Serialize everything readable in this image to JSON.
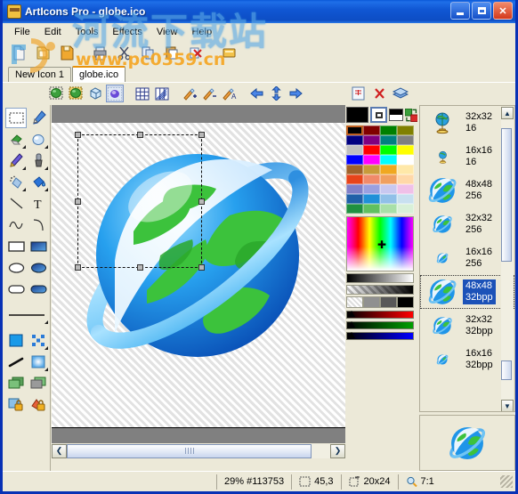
{
  "window": {
    "title": "ArtIcons Pro - globe.ico",
    "app_icon": "app-icon",
    "minimize_label": "Minimize",
    "maximize_label": "Maximize",
    "close_label": "Close",
    "close_glyph": "✕"
  },
  "menu": {
    "items": [
      {
        "label": "File",
        "mnemonic": "F"
      },
      {
        "label": "Edit",
        "mnemonic": "E"
      },
      {
        "label": "Tools",
        "mnemonic": "T"
      },
      {
        "label": "Effects",
        "mnemonic": "E"
      },
      {
        "label": "View",
        "mnemonic": "V"
      },
      {
        "label": "Help",
        "mnemonic": "H"
      }
    ]
  },
  "main_toolbar": {
    "buttons": [
      {
        "name": "new-icon-button",
        "icon": "new-document-icon"
      },
      {
        "name": "open-button",
        "icon": "open-folder-icon"
      },
      {
        "name": "save-button",
        "icon": "save-disk-icon"
      },
      {
        "name": "print-button",
        "icon": "print-icon"
      },
      {
        "name": "cut-button",
        "icon": "scissors-icon"
      },
      {
        "name": "copy-button",
        "icon": "copy-icon"
      },
      {
        "name": "paste-button",
        "icon": "paste-icon"
      },
      {
        "name": "delete-button",
        "icon": "delete-red-x-icon"
      },
      {
        "name": "properties-button",
        "icon": "properties-icon"
      }
    ]
  },
  "tabs": {
    "items": [
      {
        "label": "New Icon 1",
        "active": false
      },
      {
        "label": "globe.ico",
        "active": true
      }
    ]
  },
  "image_toolbar": {
    "buttons": [
      {
        "name": "add-image-button",
        "icon": "green-image-add-icon",
        "selected": false
      },
      {
        "name": "duplicate-image-button",
        "icon": "green-image-copy-icon",
        "selected": false
      },
      {
        "name": "image-3d-button",
        "icon": "cube-icon",
        "selected": false
      },
      {
        "name": "transparency-button",
        "icon": "alpha-blob-icon",
        "selected": true
      },
      {
        "name": "grid-button",
        "icon": "grid-icon",
        "selected": false
      },
      {
        "name": "pixel-grid-button",
        "icon": "pixel-grid-icon",
        "selected": false
      },
      {
        "name": "zoom-in-button",
        "icon": "magic-wand-plus-icon",
        "selected": false
      },
      {
        "name": "zoom-out-button",
        "icon": "magic-wand-minus-icon",
        "selected": false
      },
      {
        "name": "auto-button",
        "icon": "magic-wand-a-icon",
        "selected": false
      },
      {
        "name": "move-left-button",
        "icon": "arrow-left-blue-icon",
        "selected": false
      },
      {
        "name": "move-vertical-button",
        "icon": "arrow-updown-blue-icon",
        "selected": false
      },
      {
        "name": "move-right-button",
        "icon": "arrow-right-blue-icon",
        "selected": false
      }
    ],
    "right_buttons": [
      {
        "name": "format-button",
        "icon": "page-format-icon"
      },
      {
        "name": "remove-format-button",
        "icon": "red-x-icon"
      },
      {
        "name": "layers-button",
        "icon": "layers-icon"
      }
    ]
  },
  "tool_palette": {
    "rows": [
      [
        {
          "name": "select-rectangle-tool",
          "icon": "marquee-icon",
          "selected": true
        },
        {
          "name": "pen-tool",
          "icon": "pen-icon",
          "selected": false
        }
      ],
      [
        {
          "name": "eraser-tool",
          "icon": "eraser-icon",
          "selected": false
        },
        {
          "name": "color-eraser-tool",
          "icon": "drop-eraser-icon",
          "selected": false
        }
      ],
      [
        {
          "name": "pencil-tool",
          "icon": "pencil-icon",
          "selected": false
        },
        {
          "name": "brush-tool",
          "icon": "brush-icon",
          "selected": false
        }
      ],
      [
        {
          "name": "airbrush-tool",
          "icon": "airbrush-icon",
          "selected": false
        },
        {
          "name": "fill-tool",
          "icon": "paint-bucket-icon",
          "selected": false
        }
      ],
      [
        {
          "name": "line-tool",
          "icon": "line-icon",
          "selected": false
        },
        {
          "name": "text-tool",
          "icon": "text-t-icon",
          "selected": false
        }
      ],
      [
        {
          "name": "curve-tool",
          "icon": "wave-curve-icon",
          "selected": false
        },
        {
          "name": "arc-tool",
          "icon": "arc-icon",
          "selected": false
        }
      ],
      [
        {
          "name": "rectangle-outline-tool",
          "icon": "rectangle-outline-icon",
          "selected": false
        },
        {
          "name": "rectangle-filled-tool",
          "icon": "rectangle-filled-icon",
          "selected": false
        }
      ],
      [
        {
          "name": "ellipse-outline-tool",
          "icon": "ellipse-outline-icon",
          "selected": false
        },
        {
          "name": "ellipse-filled-tool",
          "icon": "ellipse-filled-icon",
          "selected": false
        }
      ],
      [
        {
          "name": "rounded-rect-outline-tool",
          "icon": "rounded-rect-outline-icon",
          "selected": false
        },
        {
          "name": "rounded-rect-filled-tool",
          "icon": "rounded-rect-filled-icon",
          "selected": false
        }
      ]
    ],
    "line_width_selector": {
      "name": "line-width-selector",
      "icon": "line-thickness-icon"
    },
    "extras": [
      [
        {
          "name": "solid-fill-style",
          "icon": "solid-square-icon"
        },
        {
          "name": "pattern-fill-style",
          "icon": "pattern-dots-icon"
        }
      ],
      [
        {
          "name": "gradient-line-style",
          "icon": "gradient-stroke-icon"
        },
        {
          "name": "gradient-fill-style",
          "icon": "gradient-fill-icon"
        }
      ],
      [
        {
          "name": "image-layer-green",
          "icon": "layer-green-icon"
        },
        {
          "name": "image-layer-gray",
          "icon": "layer-gray-icon"
        }
      ],
      [
        {
          "name": "lock-image-button",
          "icon": "lock-blue-icon"
        },
        {
          "name": "lock-alpha-button",
          "icon": "lock-orange-icon"
        }
      ]
    ]
  },
  "colors": {
    "foreground": "#000000",
    "background": "#ffffff",
    "selected_swatch_index": 0,
    "palette": [
      "#000000",
      "#800000",
      "#008000",
      "#808000",
      "#000080",
      "#800080",
      "#008080",
      "#808080",
      "#c0c0c0",
      "#ff0000",
      "#00ff00",
      "#ffff00",
      "#0000ff",
      "#ff00ff",
      "#00ffff",
      "#ffffff",
      "#a0622a",
      "#c89a3a",
      "#f0a820",
      "#ffe8a8",
      "#e8441a",
      "#f08a6a",
      "#f0a060",
      "#ffd8a8",
      "#8080c8",
      "#9aa0e0",
      "#c8c8f0",
      "#f0c0e8",
      "#2060a8",
      "#2090d8",
      "#90c0e8",
      "#c8e0f0",
      "#209040",
      "#60c060",
      "#a8e0a8",
      "#d8f0d8"
    ],
    "alpha_chips": [
      "#e8e8e8",
      "#909090",
      "#585858",
      "#000000"
    ],
    "channels": [
      {
        "name": "red-channel-slider",
        "color": "#ff0000"
      },
      {
        "name": "green-channel-slider",
        "color": "#00a000"
      },
      {
        "name": "blue-channel-slider",
        "color": "#0000ff"
      }
    ]
  },
  "icon_list": {
    "items": [
      {
        "size": "32x32",
        "depth": "16",
        "thumb": "globe-stand-32",
        "selected": false
      },
      {
        "size": "16x16",
        "depth": "16",
        "thumb": "globe-stand-16",
        "selected": false
      },
      {
        "size": "48x48",
        "depth": "256",
        "thumb": "globe-orbit-48",
        "selected": false
      },
      {
        "size": "32x32",
        "depth": "256",
        "thumb": "globe-orbit-32",
        "selected": false
      },
      {
        "size": "16x16",
        "depth": "256",
        "thumb": "globe-orbit-16",
        "selected": false
      },
      {
        "size": "48x48",
        "depth": "32bpp",
        "thumb": "globe-orbit-48",
        "selected": true
      },
      {
        "size": "32x32",
        "depth": "32bpp",
        "thumb": "globe-orbit-32",
        "selected": false
      },
      {
        "size": "16x16",
        "depth": "32bpp",
        "thumb": "globe-orbit-16",
        "selected": false
      }
    ],
    "scroll_up_glyph": "▲",
    "scroll_down_glyph": "▼"
  },
  "preview": {
    "name": "icon-preview",
    "thumb": "globe-orbit-48"
  },
  "canvas": {
    "horizontal_scroll_left_glyph": "❮",
    "horizontal_scroll_right_glyph": "❯"
  },
  "status_bar": {
    "zoom_and_color": "29% #113753",
    "cursor_position": "45,3",
    "selection_size": "20x24",
    "ratio": "7:1"
  },
  "watermark": {
    "chinese": "河流下载站",
    "url": "www.pc0359.cn"
  }
}
